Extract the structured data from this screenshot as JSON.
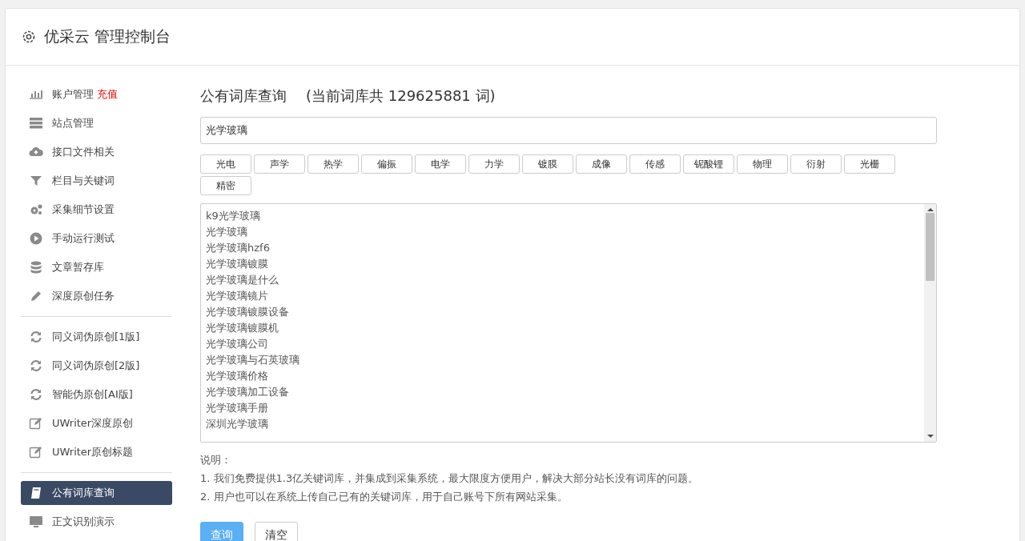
{
  "header": {
    "title": "优采云 管理控制台"
  },
  "sidebar": {
    "groups": [
      [
        {
          "label": "账户管理",
          "badge": "充值",
          "selected": false
        },
        {
          "label": "站点管理",
          "selected": false
        },
        {
          "label": "接口文件相关",
          "selected": false
        },
        {
          "label": "栏目与关键词",
          "selected": false
        },
        {
          "label": "采集细节设置",
          "selected": false
        },
        {
          "label": "手动运行测试",
          "selected": false
        },
        {
          "label": "文章暂存库",
          "selected": false
        },
        {
          "label": "深度原创任务",
          "selected": false
        }
      ],
      [
        {
          "label": "同义词伪原创[1版]",
          "selected": false
        },
        {
          "label": "同义词伪原创[2版]",
          "selected": false
        },
        {
          "label": "智能伪原创[AI版]",
          "selected": false
        },
        {
          "label": "UWriter深度原创",
          "selected": false
        },
        {
          "label": "UWriter原创标题",
          "selected": false
        }
      ],
      [
        {
          "label": "公有词库查询",
          "selected": true
        },
        {
          "label": "正文识别演示",
          "selected": false
        }
      ]
    ]
  },
  "main": {
    "title": "公有词库查询",
    "subtitle": "(当前词库共 129625881 词)",
    "search": {
      "value": "光学玻璃"
    },
    "tags": [
      "光电",
      "声学",
      "热学",
      "偏振",
      "电学",
      "力学",
      "镀膜",
      "成像",
      "传感",
      "铌酸锂",
      "物理",
      "衍射",
      "光栅",
      "精密"
    ],
    "results": [
      "k9光学玻璃",
      "光学玻璃",
      "光学玻璃hzf6",
      "光学玻璃镀膜",
      "光学玻璃是什么",
      "光学玻璃镜片",
      "光学玻璃镀膜设备",
      "光学玻璃镀膜机",
      "光学玻璃公司",
      "光学玻璃与石英玻璃",
      "光学玻璃价格",
      "光学玻璃加工设备",
      "光学玻璃手册",
      "深圳光学玻璃"
    ],
    "notes_title": "说明：",
    "notes": [
      "1. 我们免费提供1.3亿关键词库，并集成到采集系统，最大限度方便用户，解决大部分站长没有词库的问题。",
      "2. 用户也可以在系统上传自己已有的关键词库，用于自己账号下所有网站采集。"
    ],
    "buttons": [
      {
        "label": "查询",
        "kind": "primary"
      },
      {
        "label": "清空",
        "kind": "default"
      }
    ]
  }
}
